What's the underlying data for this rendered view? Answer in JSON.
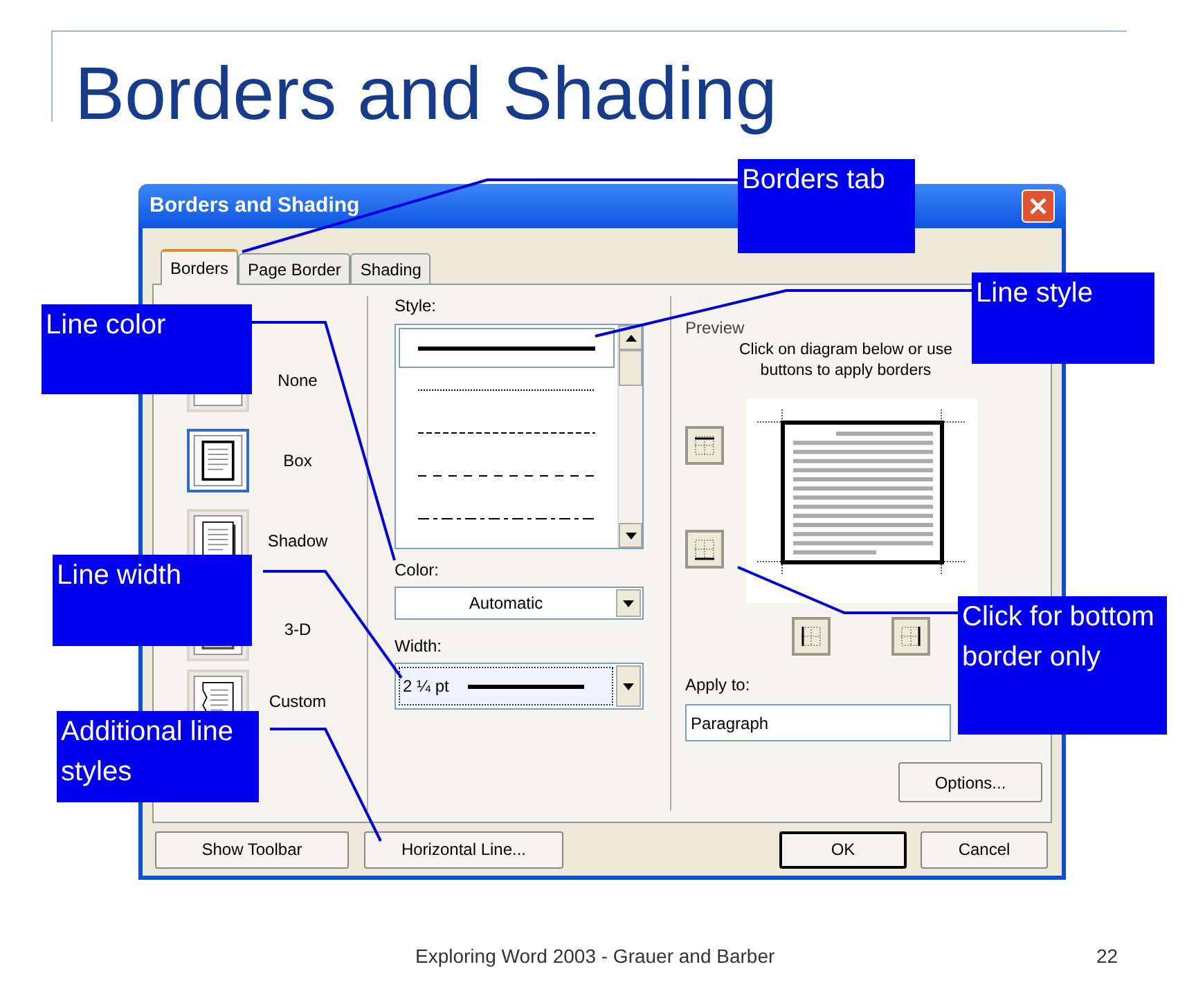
{
  "slide": {
    "title": "Borders and Shading",
    "footer": "Exploring Word 2003 - Grauer and Barber",
    "page_number": "22"
  },
  "dialog": {
    "title": "Borders and Shading",
    "tabs": [
      {
        "label": "Borders",
        "selected": true
      },
      {
        "label": "Page Border",
        "selected": false
      },
      {
        "label": "Shading",
        "selected": false
      }
    ],
    "settings": [
      {
        "label": "None",
        "kind": "none",
        "selected": false
      },
      {
        "label": "Box",
        "kind": "box",
        "selected": true
      },
      {
        "label": "Shadow",
        "kind": "shadow",
        "selected": false
      },
      {
        "label": "3-D",
        "kind": "raised",
        "selected": false
      },
      {
        "label": "Custom",
        "kind": "custom",
        "selected": false
      }
    ],
    "style_label": "Style:",
    "styles": [
      {
        "kind": "solid",
        "selected": true
      },
      {
        "kind": "dotted",
        "selected": false
      },
      {
        "kind": "dashed",
        "selected": false
      },
      {
        "kind": "dashed-wide",
        "selected": false
      },
      {
        "kind": "dash-dot",
        "selected": false
      }
    ],
    "color_label": "Color:",
    "color_value": "Automatic",
    "width_label": "Width:",
    "width_value": "2 ¼ pt",
    "preview_label": "Preview",
    "preview_hint": "Click on diagram below or use buttons to apply borders",
    "border_buttons": [
      {
        "kind": "top"
      },
      {
        "kind": "bottom"
      },
      {
        "kind": "left"
      },
      {
        "kind": "right"
      }
    ],
    "apply_label": "Apply to:",
    "apply_value": "Paragraph",
    "options_button": "Options...",
    "buttons": [
      "Show Toolbar",
      "Horizontal Line...",
      "OK",
      "Cancel"
    ]
  },
  "callouts": [
    {
      "text": "Borders tab"
    },
    {
      "text": "Line style"
    },
    {
      "text": "Line color"
    },
    {
      "text": "Line width"
    },
    {
      "text": "Click for bottom border only"
    },
    {
      "text": "Additional line styles"
    }
  ]
}
